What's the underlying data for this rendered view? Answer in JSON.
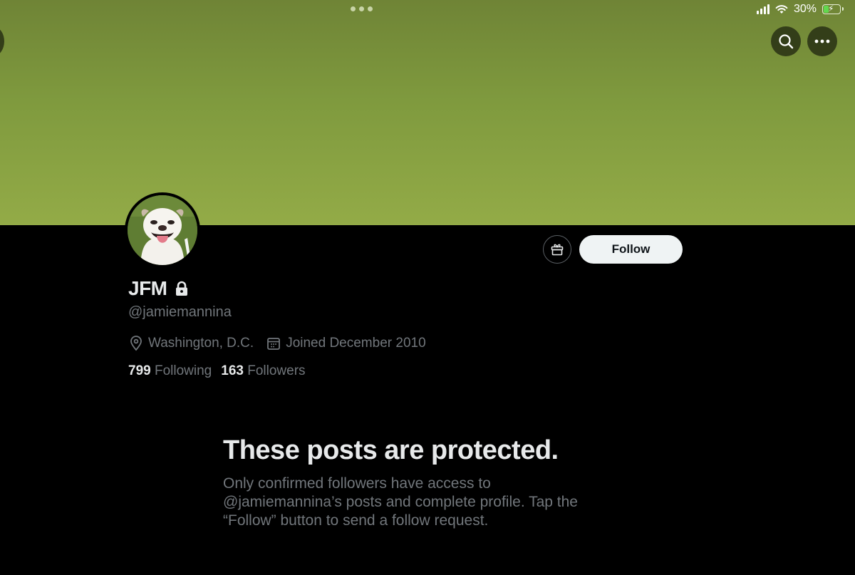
{
  "status_bar": {
    "battery": "30%"
  },
  "profile": {
    "display_name": "JFM",
    "handle": "@jamiemannina",
    "location": "Washington, D.C.",
    "joined": "Joined December 2010",
    "following_count": "799",
    "following_label": "Following",
    "followers_count": "163",
    "followers_label": "Followers"
  },
  "actions": {
    "follow_label": "Follow"
  },
  "protected": {
    "title": "These posts are protected.",
    "body": "Only confirmed followers have access to @jamiemannina’s posts and complete profile. Tap the “Follow” button to send a follow request."
  },
  "colors": {
    "banner": "#87a040",
    "background": "#000000",
    "primary_text": "#e7e9ea",
    "secondary_text": "#71767b",
    "follow_button": "#eff3f4"
  },
  "icons": [
    "chevron-left-icon",
    "search-icon",
    "more-icon",
    "gift-icon",
    "lock-icon",
    "location-pin-icon",
    "calendar-icon",
    "signal-icon",
    "wifi-icon",
    "battery-icon"
  ]
}
